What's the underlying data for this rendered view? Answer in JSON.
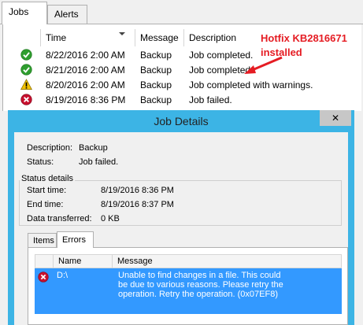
{
  "tabs": [
    {
      "label": "Jobs",
      "active": true
    },
    {
      "label": "Alerts",
      "active": false
    }
  ],
  "jobs_table": {
    "columns": [
      "Time",
      "Message",
      "Description"
    ],
    "rows": [
      {
        "status_icon": "success-icon",
        "time": "8/22/2016 2:00 AM",
        "message": "Backup",
        "description": "Job completed."
      },
      {
        "status_icon": "success-icon",
        "time": "8/21/2016 2:00 AM",
        "message": "Backup",
        "description": "Job completed."
      },
      {
        "status_icon": "warning-icon",
        "time": "8/20/2016 2:00 AM",
        "message": "Backup",
        "description": "Job completed with warnings."
      },
      {
        "status_icon": "error-icon",
        "time": "8/19/2016 8:36 PM",
        "message": "Backup",
        "description": "Job failed."
      }
    ]
  },
  "annotation": {
    "line1": "Hotfix KB2816671",
    "line2": "installed",
    "color": "#e51c23"
  },
  "dialog": {
    "title": "Job Details",
    "close_label": "✕",
    "description_label": "Description:",
    "description_value": "Backup",
    "status_label": "Status:",
    "status_value": "Job failed.",
    "status_details_title": "Status details",
    "start_label": "Start time:",
    "start_value": "8/19/2016 8:36 PM",
    "end_label": "End time:",
    "end_value": "8/19/2016 8:37 PM",
    "data_label": "Data transferred:",
    "data_value": "0 KB",
    "subtabs": [
      {
        "label": "Items",
        "active": false
      },
      {
        "label": "Errors",
        "active": true
      }
    ],
    "errors_table": {
      "columns": [
        "Name",
        "Message"
      ],
      "rows": [
        {
          "icon": "error-icon",
          "name": "D:\\",
          "message": "Unable to find changes in a file. This could be due to various reasons. Please retry the operation. Retry the operation. (0x07EF8)"
        }
      ]
    }
  },
  "colors": {
    "dialog_frame": "#3cb4e5",
    "selection": "#3399ff",
    "success": "#2f9e2f",
    "warning": "#f2c200",
    "error": "#c8102e"
  }
}
